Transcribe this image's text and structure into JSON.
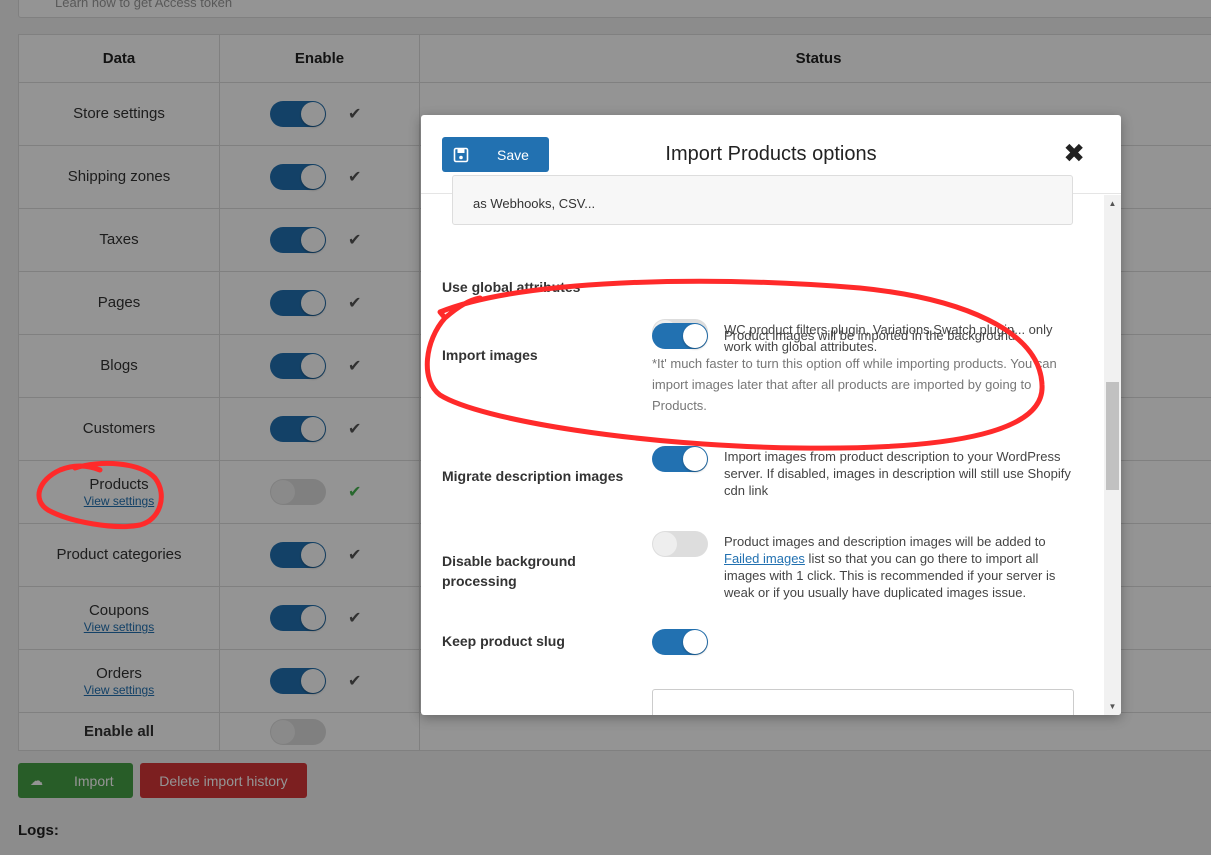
{
  "top_box": {
    "text": "Learn how to get Access token"
  },
  "table": {
    "headers": {
      "data": "Data",
      "enable": "Enable",
      "status": "Status"
    },
    "rows": [
      {
        "label": "Store settings",
        "link": "",
        "enabled": true,
        "checked": true,
        "check_color": "#555555"
      },
      {
        "label": "Shipping zones",
        "link": "",
        "enabled": true,
        "checked": true,
        "check_color": "#555555"
      },
      {
        "label": "Taxes",
        "link": "",
        "enabled": true,
        "checked": true,
        "check_color": "#555555"
      },
      {
        "label": "Pages",
        "link": "",
        "enabled": true,
        "checked": true,
        "check_color": "#555555"
      },
      {
        "label": "Blogs",
        "link": "",
        "enabled": true,
        "checked": true,
        "check_color": "#555555"
      },
      {
        "label": "Customers",
        "link": "",
        "enabled": true,
        "checked": true,
        "check_color": "#555555"
      },
      {
        "label": "Products",
        "link": "View settings",
        "enabled": false,
        "checked": true,
        "check_color": "#46b450"
      },
      {
        "label": "Product categories",
        "link": "",
        "enabled": true,
        "checked": true,
        "check_color": "#555555"
      },
      {
        "label": "Coupons",
        "link": "View settings",
        "enabled": true,
        "checked": true,
        "check_color": "#555555"
      },
      {
        "label": "Orders",
        "link": "View settings",
        "enabled": true,
        "checked": true,
        "check_color": "#555555"
      }
    ],
    "enable_all": {
      "label": "Enable all",
      "enabled": false
    }
  },
  "actions": {
    "import_label": "Import",
    "delete_label": "Delete import history"
  },
  "logs_label": "Logs:",
  "modal": {
    "title": "Import Products options",
    "save_label": "Save",
    "textbox_text": "as Webhooks, CSV...",
    "options": {
      "global_attributes": {
        "label": "Use global attributes",
        "enabled": false,
        "desc": "WC product filters plugin, Variations Swatch plugin... only work with global attributes."
      },
      "import_images": {
        "label": "Import images",
        "enabled": true,
        "desc": "Product images will be imported in the background.",
        "note": "*It' much faster to turn this option off while importing products. You can import images later that after all products are imported by going to Products."
      },
      "migrate_desc_images": {
        "label": "Migrate description images",
        "enabled": true,
        "desc": "Import images from product description to your WordPress server. If disabled, images in description will still use Shopify cdn link"
      },
      "disable_bg_processing": {
        "label": "Disable background processing",
        "enabled": false,
        "desc_link": "Failed images",
        "desc_rest": " list so that you can go there to import all images with 1 click. This is recommended if your server is weak or if you usually have duplicated images issue.",
        "desc_prefix": "Product images and description images will be added to "
      },
      "keep_slug": {
        "label": "Keep product slug",
        "enabled": true
      }
    }
  },
  "colors": {
    "accent": "#2271b1",
    "success": "#46a046",
    "danger": "#d63638",
    "annotation": "#ff2a2a"
  },
  "icons": {
    "check": "check-icon",
    "save": "floppy-disk-icon",
    "close": "close-icon",
    "import": "cloud-upload-icon"
  }
}
